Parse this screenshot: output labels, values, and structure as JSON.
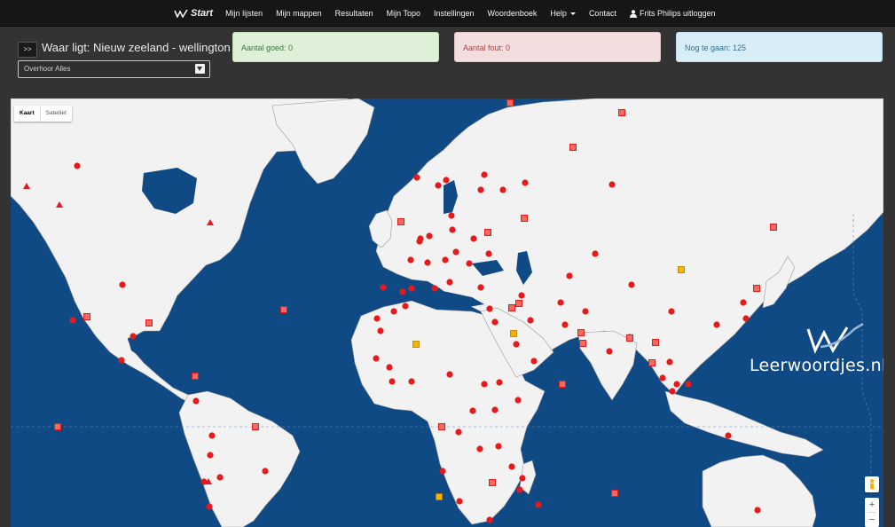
{
  "nav": {
    "brand": "Start",
    "items": [
      "Mijn lijsten",
      "Mijn mappen",
      "Resultaten",
      "Mijn Topo",
      "Instellingen",
      "Woordenboek"
    ],
    "help": "Help",
    "contact": "Contact",
    "user": "Frits Philips uitloggen"
  },
  "quiz": {
    "next_label": ">>",
    "question": "Waar ligt: Nieuw zeeland - wellington",
    "mode": "Overhoor Alles"
  },
  "stats": {
    "good": "Aantal goed: 0",
    "bad": "Aantal fout: 0",
    "todo": "Nog te gaan: 125"
  },
  "map": {
    "type_map": "Kaart",
    "type_satellite": "Satelliet",
    "zoom_in": "+",
    "zoom_out": "−",
    "watermark": "Leerwoordjes.nl",
    "colors": {
      "water": "#0f4a85",
      "land": "#f2f2f2",
      "marker": "#e8191b",
      "answered": "#f5b400"
    }
  }
}
